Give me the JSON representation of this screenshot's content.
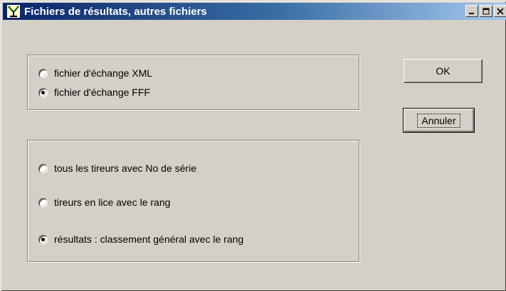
{
  "window": {
    "title": "Fichiers de résultats, autres fichiers",
    "icon": "shooting-target-icon"
  },
  "titlebar_buttons": [
    "minimize-icon",
    "maximize-icon",
    "close-icon"
  ],
  "format_group": {
    "options": [
      {
        "label": "fichier d'échange XML",
        "checked": false
      },
      {
        "label": "fichier d'échange FFF",
        "checked": true
      }
    ]
  },
  "content_group": {
    "options": [
      {
        "label": "tous les tireurs avec No de série",
        "checked": false
      },
      {
        "label": "tireurs en lice avec le rang",
        "checked": false
      },
      {
        "label": "résultats : classement général avec le rang",
        "checked": true
      }
    ]
  },
  "buttons": {
    "ok": "OK",
    "cancel": "Annuler"
  }
}
